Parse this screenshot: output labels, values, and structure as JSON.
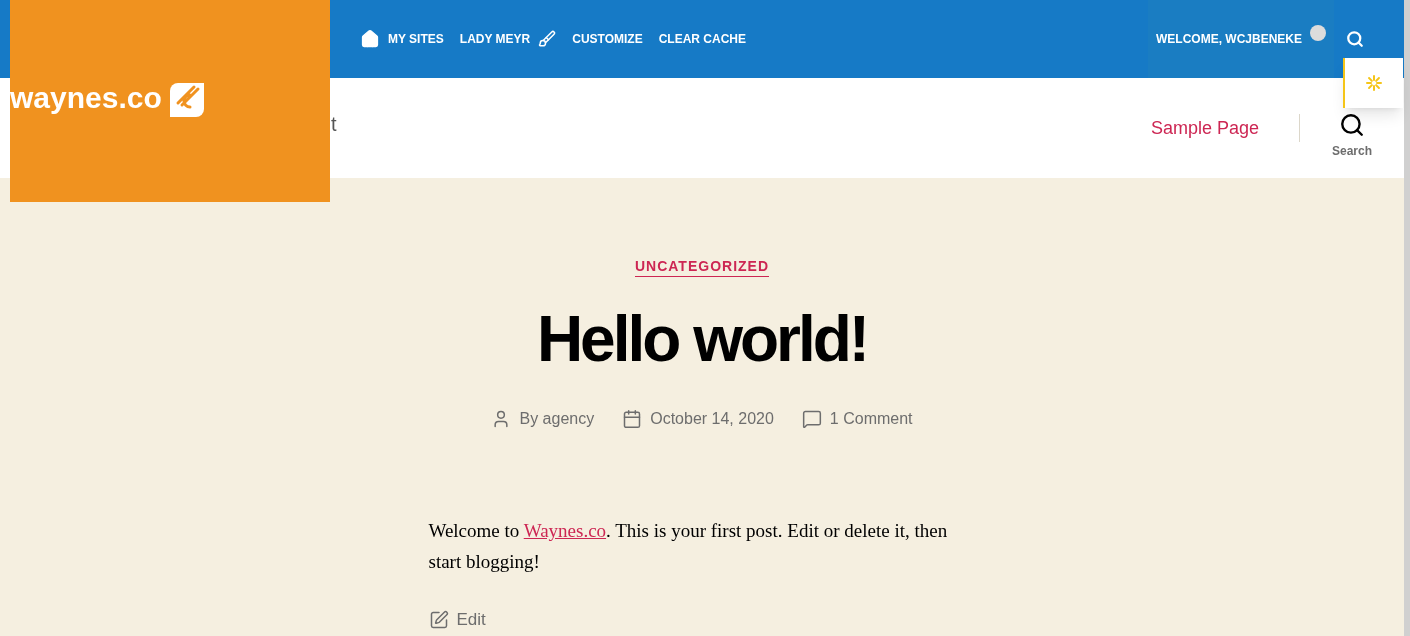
{
  "admin_bar": {
    "items": [
      {
        "kind": "sites",
        "label": "MY SITES"
      },
      {
        "kind": "site",
        "label": "LADY MEYR"
      },
      {
        "kind": "customize",
        "label": "CUSTOMIZE"
      },
      {
        "kind": "plain",
        "label": "CLEAR CACHE"
      }
    ],
    "welcome": "WELCOME, WCJBENEKE"
  },
  "logo": {
    "text": "waynes.co"
  },
  "header": {
    "title_fragment": "t",
    "nav": [
      "Sample Page"
    ],
    "search_label": "Search"
  },
  "post": {
    "category": "UNCATEGORIZED",
    "title": "Hello world!",
    "meta": [
      {
        "kind": "author",
        "text": "By agency"
      },
      {
        "kind": "date",
        "text": "October 14, 2020"
      },
      {
        "kind": "comments",
        "text": "1 Comment"
      }
    ],
    "paragraph": {
      "before": "Welcome to ",
      "link": "Waynes.co",
      "after": ". This is your first post. Edit or delete it, then start blogging!"
    },
    "edit": "Edit"
  }
}
